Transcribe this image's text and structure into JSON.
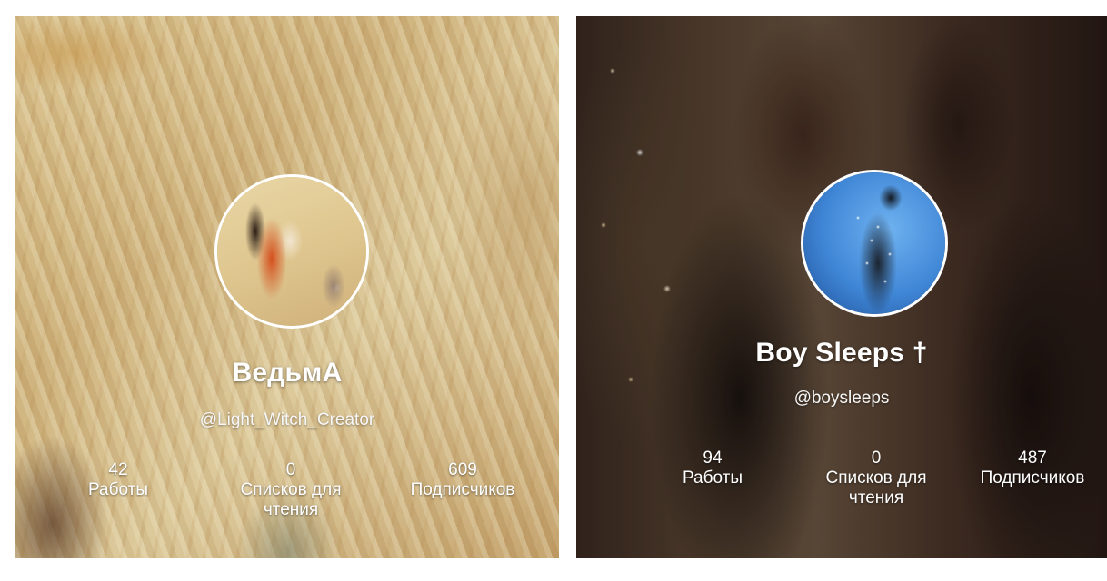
{
  "profiles": [
    {
      "name": "ВедьмА",
      "handle": "@Light_Witch_Creator",
      "stats": [
        {
          "value": "42",
          "label": "Работы"
        },
        {
          "value": "0",
          "label": "Списков для чтения"
        },
        {
          "value": "609",
          "label": "Подписчиков"
        }
      ],
      "avatar_icon": "fox-and-rabbit-illustration-avatar",
      "background_icon": "painted-blonde-hair-banner"
    },
    {
      "name": "Boy Sleeps †",
      "handle": "@boysleeps",
      "stats": [
        {
          "value": "94",
          "label": "Работы"
        },
        {
          "value": "0",
          "label": "Списков для чтения"
        },
        {
          "value": "487",
          "label": "Подписчиков"
        }
      ],
      "avatar_icon": "figure-with-string-lights-avatar",
      "background_icon": "two-people-christmas-tree-banner"
    }
  ]
}
